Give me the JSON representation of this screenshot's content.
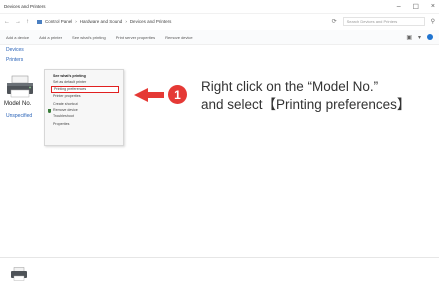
{
  "window": {
    "title": "Devices and Printers",
    "controls": [
      "–",
      "☐",
      "×"
    ]
  },
  "address": {
    "nav": [
      "←",
      "→",
      "↑",
      "⟳"
    ],
    "path": [
      "Control Panel",
      "Hardware and Sound",
      "Devices and Printers"
    ],
    "separator": "›",
    "search_placeholder": "Search Devices and Printers"
  },
  "toolbar": {
    "items": [
      "Add a device",
      "Add a printer",
      "See what's printing",
      "Print server properties",
      "Remove device"
    ],
    "view_icon": "▣",
    "view_chevron": "▾"
  },
  "sections": {
    "devices": "Devices",
    "printers": "Printers",
    "unspecified": "Unspecified"
  },
  "printer": {
    "label": "Model No."
  },
  "context_menu": {
    "items": [
      "See what's printing",
      "Set as default printer",
      "Printing preferences",
      "Printer properties",
      "Create shortcut",
      "Remove device",
      "Troubleshoot",
      "Properties"
    ],
    "highlighted_index": 2
  },
  "annotation": {
    "step": "1",
    "line1": "Right click on the “Model No.”",
    "line2": "and select【Printing preferences】",
    "color": "#e53935"
  }
}
